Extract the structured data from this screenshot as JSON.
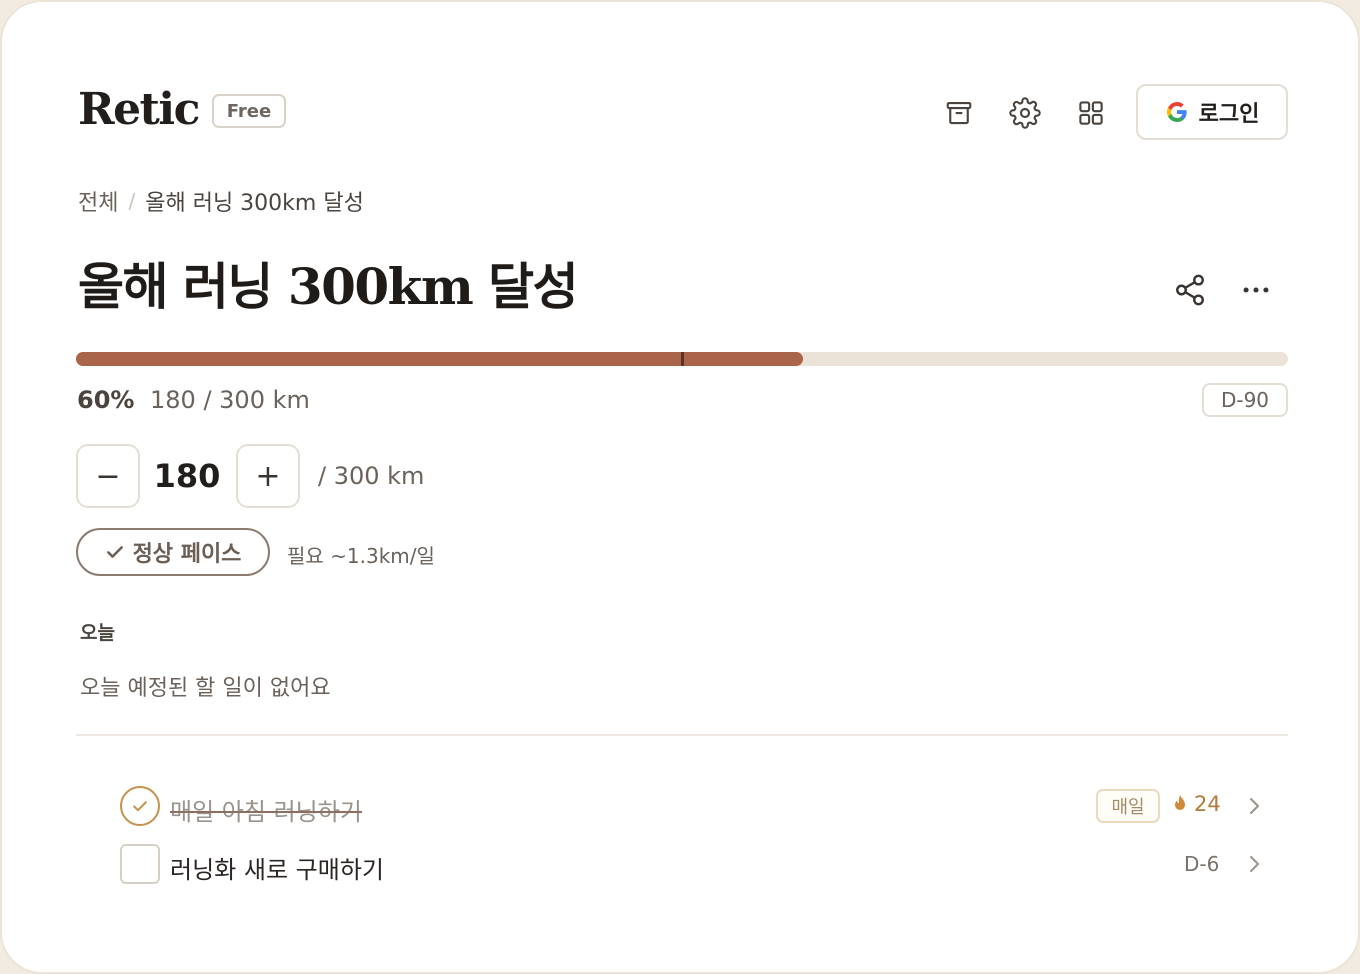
{
  "app": {
    "name": "Retic",
    "plan": "Free"
  },
  "header": {
    "login_label": "로그인",
    "icons": [
      "archive-icon",
      "gear-icon",
      "grid-icon",
      "google-icon"
    ]
  },
  "breadcrumb": {
    "root": "전체",
    "separator": "/",
    "current": "올해 러닝 300km 달성"
  },
  "goal": {
    "title": "올해 러닝 300km 달성",
    "progress": {
      "percent_label": "60%",
      "current": 180,
      "target": 300,
      "unit": "km",
      "fraction": 0.6,
      "amount_label": "180 / 300 km"
    },
    "dday": "D-90",
    "stepper": {
      "minus": "−",
      "value": "180",
      "plus": "+",
      "target_label": "/ 300 km"
    },
    "pace": {
      "label": "정상 페이스",
      "need": "필요 ~1.3km/일"
    },
    "colors": {
      "accent": "#a9644a",
      "track": "#ebe3d8"
    }
  },
  "today": {
    "label": "오늘",
    "empty": "오늘 예정된 할 일이 없어요"
  },
  "tasks": [
    {
      "label": "매일 아침 러닝하기",
      "done": true,
      "repeat": "매일",
      "streak": "24"
    },
    {
      "label": "러닝화 새로 구매하기",
      "done": false,
      "dday": "D-6"
    }
  ]
}
